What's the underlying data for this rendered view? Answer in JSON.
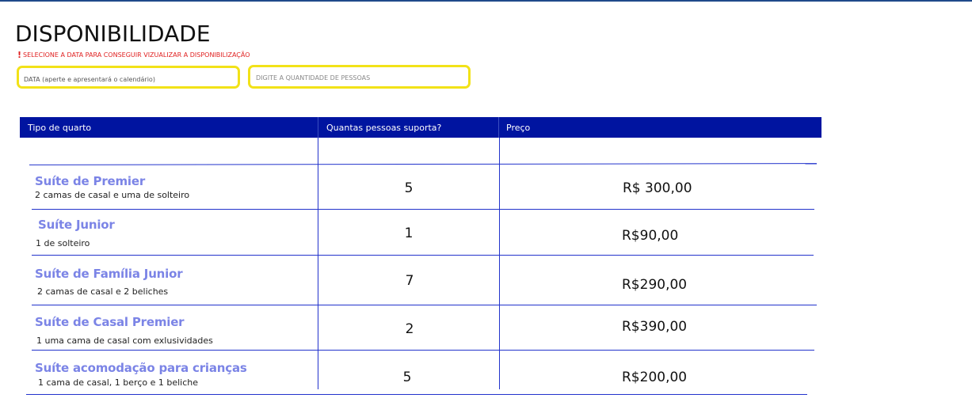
{
  "page": {
    "title": "DISPONIBILIDADE",
    "warning_mark": "!",
    "warning_text": "SELECIONE A DATA PARA CONSEGUIR VIZUALIZAR A DISPONIBILIZAÇÃO"
  },
  "form": {
    "date_label": "DATA (aperte e apresentará o calendário)",
    "quantity_label": "DIGITE A QUANTIDADE DE PESSOAS"
  },
  "table": {
    "headers": [
      "Tipo de quarto",
      "Quantas pessoas suporta?",
      "Preço"
    ],
    "rows": [
      {
        "name": "Suíte de Premier",
        "description": "2  camas de casal e uma de solteiro",
        "capacity": "5",
        "price": "R$ 300,00"
      },
      {
        "name": "Suíte Junior",
        "description": "1 de solteiro",
        "capacity": "1",
        "price": "R$90,00"
      },
      {
        "name": "Suíte de Família Junior",
        "description": "2  camas de casal e 2 beliches",
        "capacity": "7",
        "price": "R$290,00"
      },
      {
        "name": "Suíte de Casal Premier",
        "description": "1 uma cama de casal com exlusividades",
        "capacity": "2",
        "price": "R$390,00"
      },
      {
        "name": "Suíte acomodação para crianças",
        "description": "1 cama de casal,  1 berço e 1 beliche",
        "capacity": "5",
        "price": "R$200,00"
      }
    ]
  },
  "colors": {
    "header_bg": "#0014a0",
    "field_border": "#f2e218",
    "warning": "#e02020",
    "room_name": "#7b84e6",
    "grid_line": "#2233cc"
  }
}
